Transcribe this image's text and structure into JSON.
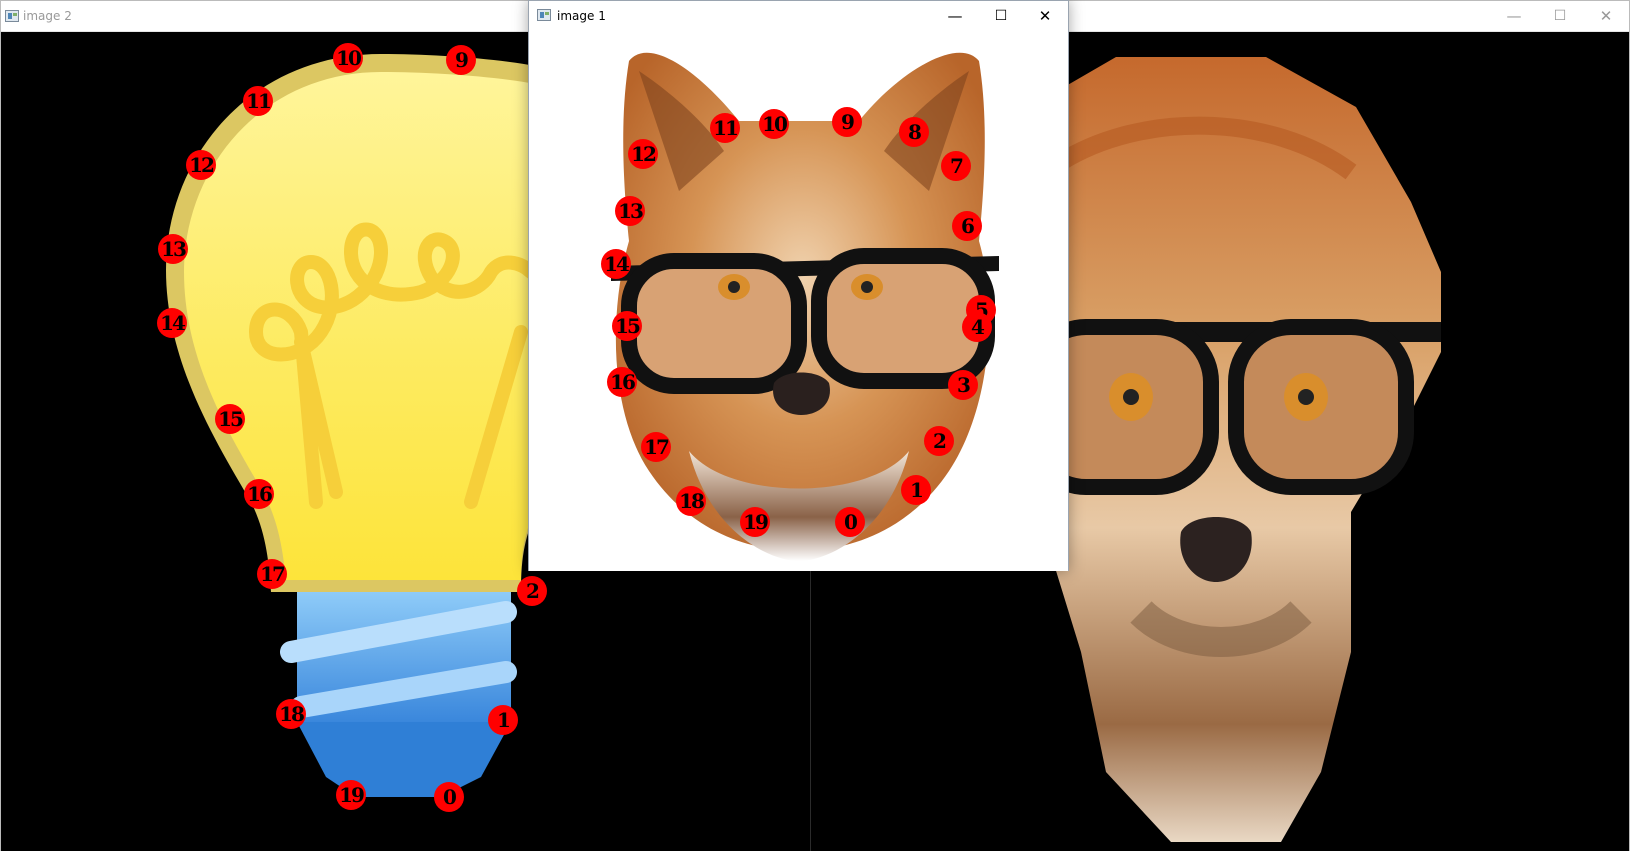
{
  "window_back": {
    "title": "image 2",
    "buttons": {
      "minimize": "—",
      "maximize": "☐",
      "close": "✕"
    }
  },
  "window_front": {
    "title": "image 1",
    "buttons": {
      "minimize": "—",
      "maximize": "☐",
      "close": "✕"
    }
  },
  "landmarks_bulb": [
    "10",
    "9",
    "11",
    "12",
    "13",
    "14",
    "15",
    "16",
    "17",
    "2",
    "18",
    "1",
    "19",
    "0"
  ],
  "landmarks_fox": [
    "11",
    "10",
    "9",
    "8",
    "12",
    "7",
    "13",
    "6",
    "14",
    "5",
    "15",
    "4",
    "16",
    "3",
    "17",
    "2",
    "18",
    "1",
    "19",
    "0"
  ],
  "colors": {
    "landmark": "#ff0000",
    "bulb_glass": "#fde94f",
    "bulb_outline": "#e0c95a",
    "bulb_base": "#5aa9ef",
    "fur": "#c8743a"
  }
}
